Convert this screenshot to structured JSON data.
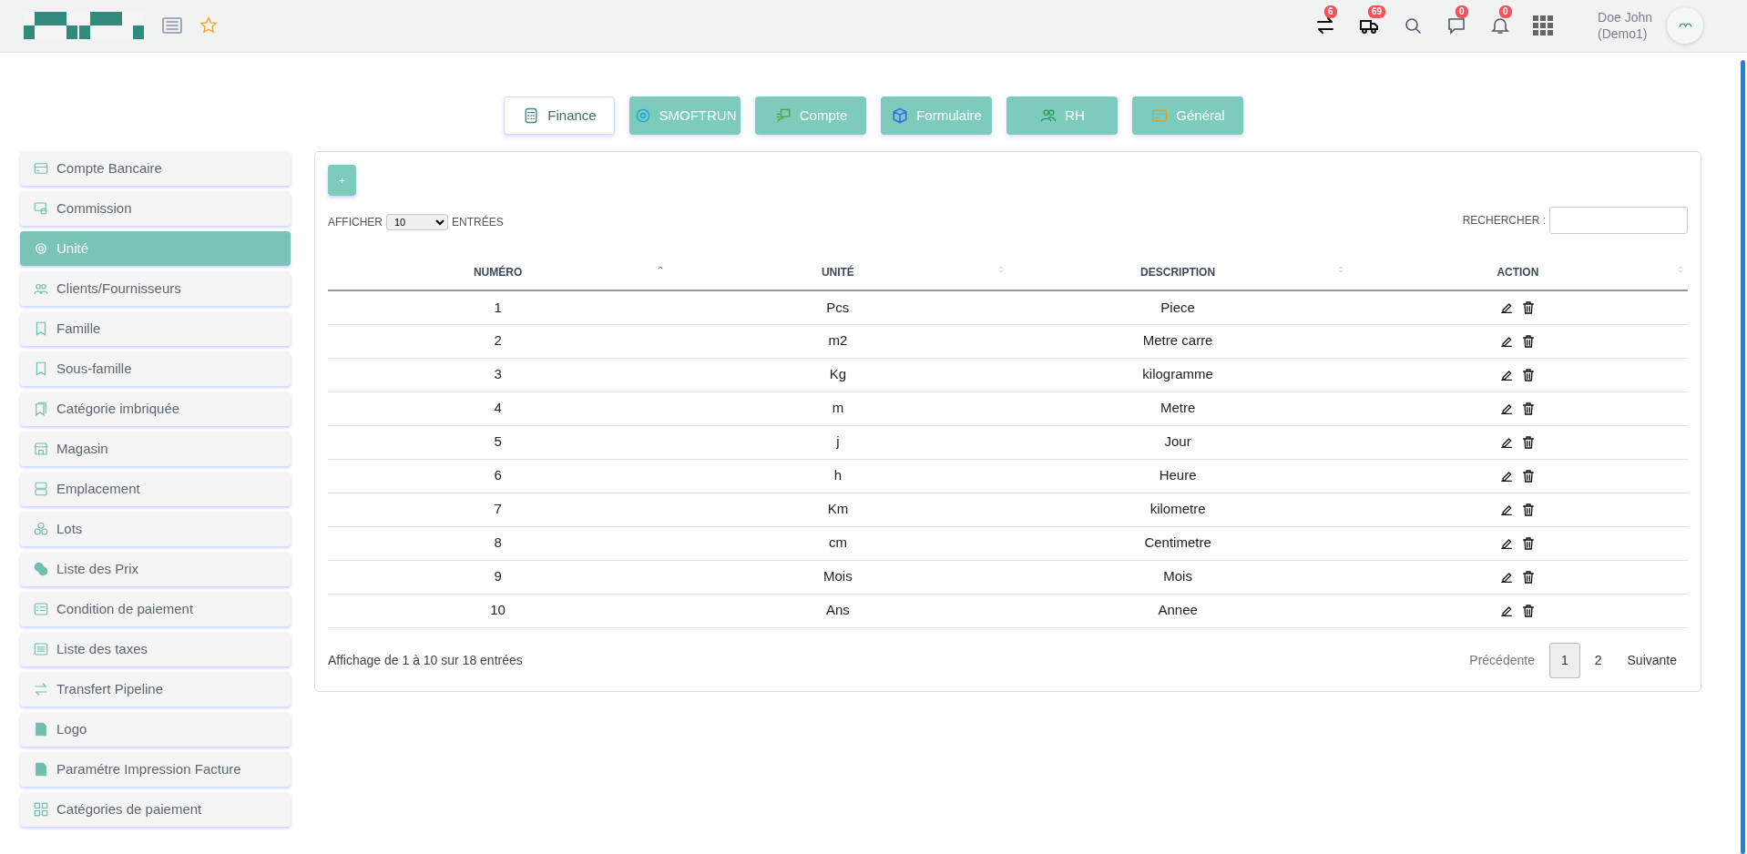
{
  "header": {
    "badges": [
      {
        "count": "6"
      },
      {
        "count": "69"
      },
      {
        "count": "0"
      },
      {
        "count": "0"
      }
    ],
    "user": {
      "name": "Doe John",
      "company": "(Demo1)"
    }
  },
  "modules": [
    {
      "label": "Finance",
      "selected": true
    },
    {
      "label": "SMOFTRUN",
      "selected": false
    },
    {
      "label": "Compte",
      "selected": false
    },
    {
      "label": "Formulaire",
      "selected": false
    },
    {
      "label": "RH",
      "selected": false
    },
    {
      "label": "Général",
      "selected": false
    }
  ],
  "sidebar": {
    "items": [
      {
        "label": "Compte Bancaire",
        "selected": false
      },
      {
        "label": "Commission",
        "selected": false
      },
      {
        "label": "Unité",
        "selected": true
      },
      {
        "label": "Clients/Fournisseurs",
        "selected": false
      },
      {
        "label": "Famille",
        "selected": false
      },
      {
        "label": "Sous-famille",
        "selected": false
      },
      {
        "label": "Catégorie imbriquée",
        "selected": false
      },
      {
        "label": "Magasin",
        "selected": false
      },
      {
        "label": "Emplacement",
        "selected": false
      },
      {
        "label": "Lots",
        "selected": false
      },
      {
        "label": "Liste des Prix",
        "selected": false
      },
      {
        "label": "Condition de paiement",
        "selected": false
      },
      {
        "label": "Liste des taxes",
        "selected": false
      },
      {
        "label": "Transfert Pipeline",
        "selected": false
      },
      {
        "label": "Logo",
        "selected": false
      },
      {
        "label": "Paramétre Impression Facture",
        "selected": false
      },
      {
        "label": "Catégories de paiement",
        "selected": false
      }
    ]
  },
  "table": {
    "add_button": "+",
    "length": {
      "before": "AFFICHER",
      "value": "10",
      "after": "ENTRÉES"
    },
    "search": {
      "label": "RECHERCHER :"
    },
    "columns": [
      {
        "label": "NUMÉRO",
        "sorted": true
      },
      {
        "label": "UNITÉ",
        "sorted": false
      },
      {
        "label": "DESCRIPTION",
        "sorted": false
      },
      {
        "label": "ACTION",
        "sorted": false
      }
    ],
    "rows": [
      [
        "1",
        "Pcs",
        "Piece"
      ],
      [
        "2",
        "m2",
        "Metre carre"
      ],
      [
        "3",
        "Kg",
        "kilogramme"
      ],
      [
        "4",
        "m",
        "Metre"
      ],
      [
        "5",
        "j",
        "Jour"
      ],
      [
        "6",
        "h",
        "Heure"
      ],
      [
        "7",
        "Km",
        "kilometre"
      ],
      [
        "8",
        "cm",
        "Centimetre"
      ],
      [
        "9",
        "Mois",
        "Mois"
      ],
      [
        "10",
        "Ans",
        "Annee"
      ]
    ],
    "info": "Affichage de 1 à 10 sur 18 entrées",
    "pagination": {
      "previous": {
        "label": "Précédente",
        "disabled": true
      },
      "pages": [
        {
          "label": "1",
          "selected": true
        },
        {
          "label": "2",
          "selected": false
        }
      ],
      "next": {
        "label": "Suivante",
        "disabled": false
      }
    }
  }
}
